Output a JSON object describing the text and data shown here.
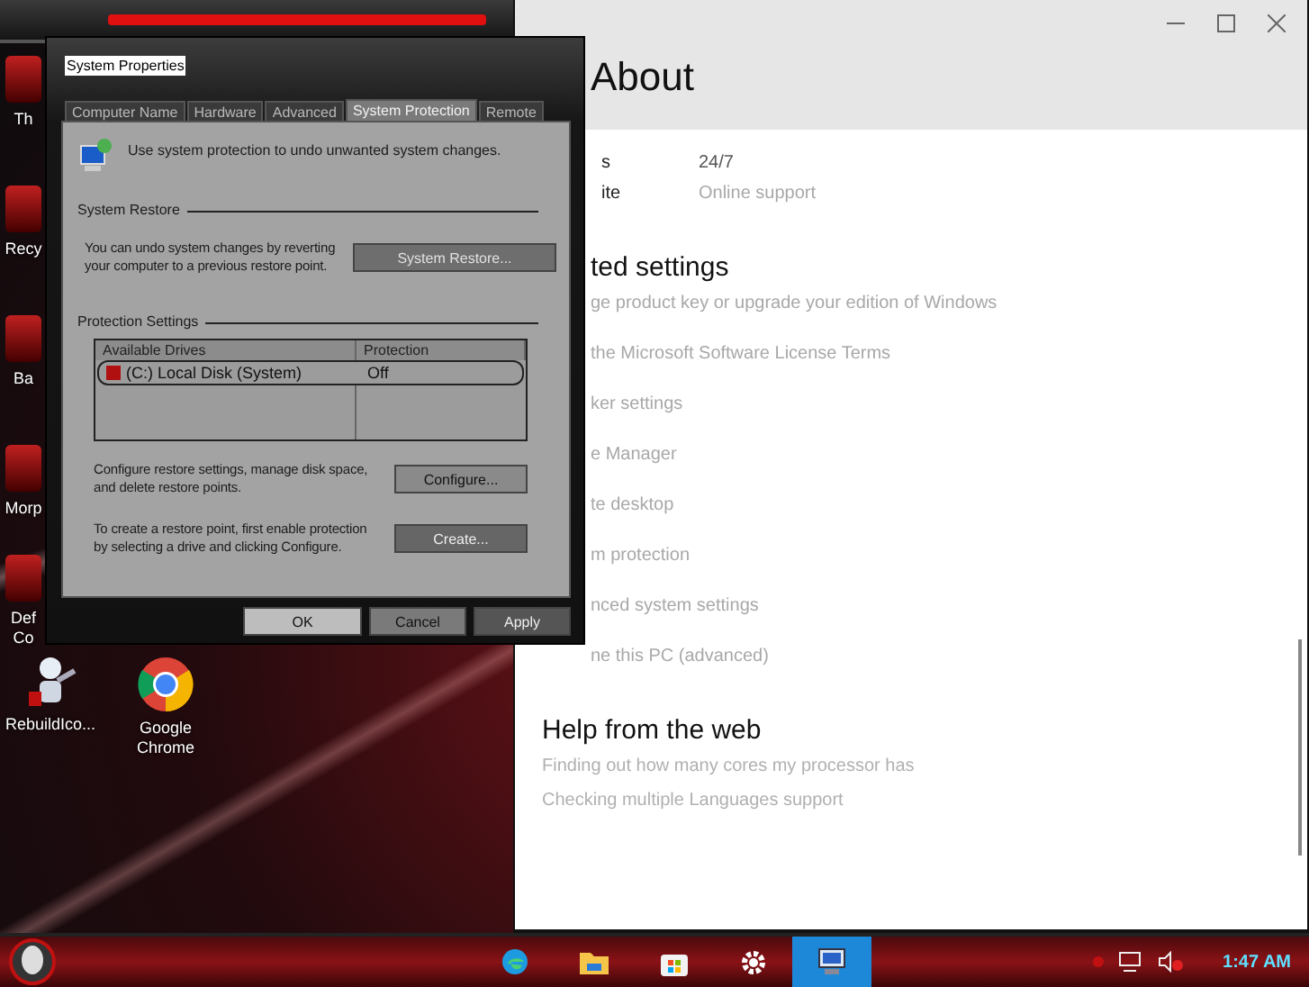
{
  "desktop_icons": [
    {
      "label": "Th"
    },
    {
      "label": "Recy"
    },
    {
      "label": "Ba"
    },
    {
      "label": "Morp"
    },
    {
      "label": "Def Co"
    }
  ],
  "desktop_icons_bottom": [
    {
      "label": "RebuildIco...",
      "kind": "robot"
    },
    {
      "label": "Google Chrome",
      "kind": "browser"
    }
  ],
  "settings": {
    "heading": "About",
    "rows": [
      {
        "label": "s",
        "value": "24/7",
        "kind": "text"
      },
      {
        "label": "ite",
        "value": "Online support",
        "kind": "link"
      }
    ],
    "related": {
      "heading": "ted settings",
      "links": [
        "ge product key or upgrade your edition of Windows",
        "the Microsoft Software License Terms",
        "ker settings",
        "e Manager",
        "te desktop",
        "m protection",
        "nced system settings",
        "ne this PC (advanced)"
      ]
    },
    "help": {
      "heading": "Help from the web",
      "links": [
        "Finding out how many cores my processor has",
        "Checking multiple Languages support"
      ]
    }
  },
  "dialog": {
    "title": "System Properties",
    "tabs": [
      {
        "label": "Computer Name",
        "selected": false
      },
      {
        "label": "Hardware",
        "selected": false
      },
      {
        "label": "Advanced",
        "selected": false
      },
      {
        "label": "System Protection",
        "selected": true
      },
      {
        "label": "Remote",
        "selected": false
      }
    ],
    "intro": "Use system protection to undo unwanted system changes.",
    "restore": {
      "heading": "System Restore",
      "text": "You can undo system changes by reverting your computer to a previous restore point.",
      "button": "System Restore..."
    },
    "protection": {
      "heading": "Protection Settings",
      "columns": [
        "Available Drives",
        "Protection"
      ],
      "rows": [
        {
          "drive": "(C:) Local Disk (System)",
          "protection": "Off",
          "selected": true
        }
      ],
      "configure_text": "Configure restore settings, manage disk space, and delete restore points.",
      "configure_button": "Configure...",
      "create_text": "To create a restore point, first enable protection by selecting a drive and clicking Configure.",
      "create_button": "Create..."
    },
    "buttons": [
      {
        "label": "OK",
        "kind": "default"
      },
      {
        "label": "Cancel",
        "kind": "normal"
      },
      {
        "label": "Apply",
        "kind": "dark"
      }
    ]
  },
  "taskbar": {
    "apps": [
      {
        "kind": "edge",
        "active": false
      },
      {
        "kind": "folder",
        "active": false
      },
      {
        "kind": "store",
        "active": false
      },
      {
        "kind": "gear",
        "active": false
      },
      {
        "kind": "computer",
        "active": true
      }
    ],
    "clock": "1:47 AM"
  }
}
